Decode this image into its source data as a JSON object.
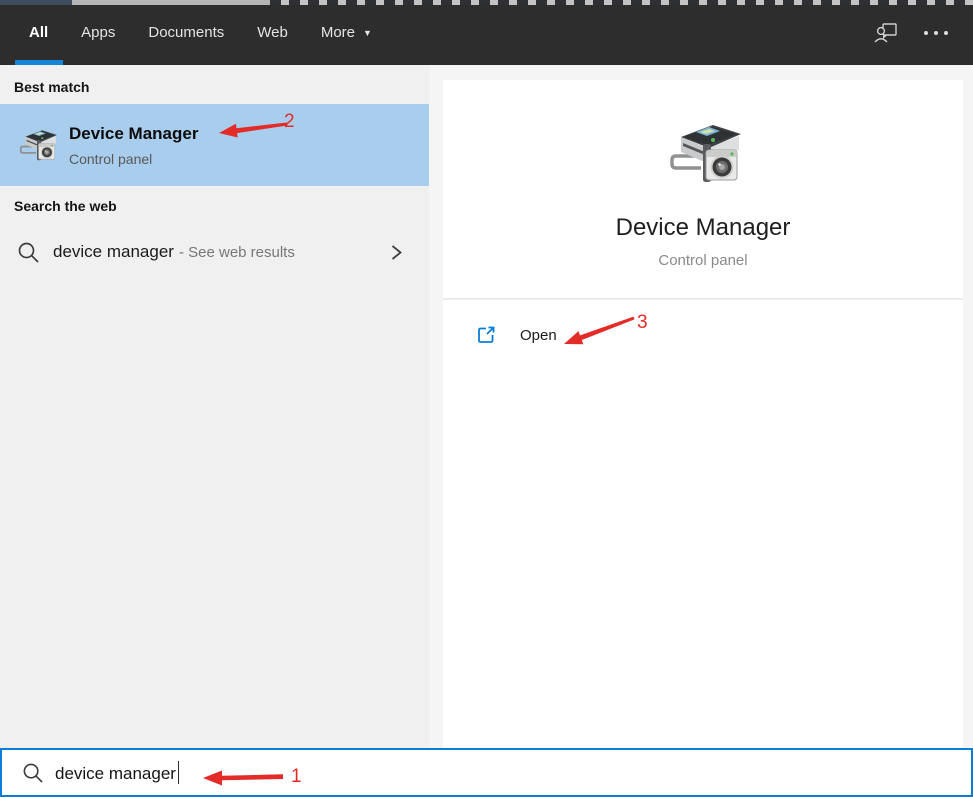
{
  "header": {
    "tabs": [
      {
        "label": "All",
        "active": true
      },
      {
        "label": "Apps",
        "active": false
      },
      {
        "label": "Documents",
        "active": false
      },
      {
        "label": "Web",
        "active": false
      },
      {
        "label": "More",
        "active": false,
        "dropdown": true
      }
    ],
    "dropdown_glyph": "▼"
  },
  "left_panel": {
    "best_match": {
      "header": "Best match",
      "item": {
        "title": "Device Manager",
        "subtitle": "Control panel",
        "icon": "device-manager-icon"
      }
    },
    "web_search": {
      "header": "Search the web",
      "query": "device manager",
      "suffix": "- See web results",
      "icon": "search-icon"
    }
  },
  "right_panel": {
    "title": "Device Manager",
    "subtitle": "Control panel",
    "icon": "device-manager-icon",
    "open_label": "Open",
    "open_icon": "open-external-icon"
  },
  "search_bar": {
    "value": "device manager",
    "icon": "search-icon"
  },
  "annotations": {
    "search_step": "1",
    "best_match_step": "2",
    "open_step": "3"
  },
  "colors": {
    "accent_blue": "#0b7cd7",
    "selection_blue": "#a9cded",
    "annotation_red": "#e32b27",
    "header_bg": "#2d2d2d",
    "left_panel_bg": "#f0f0f0",
    "right_panel_bg": "#f5f5f5"
  }
}
